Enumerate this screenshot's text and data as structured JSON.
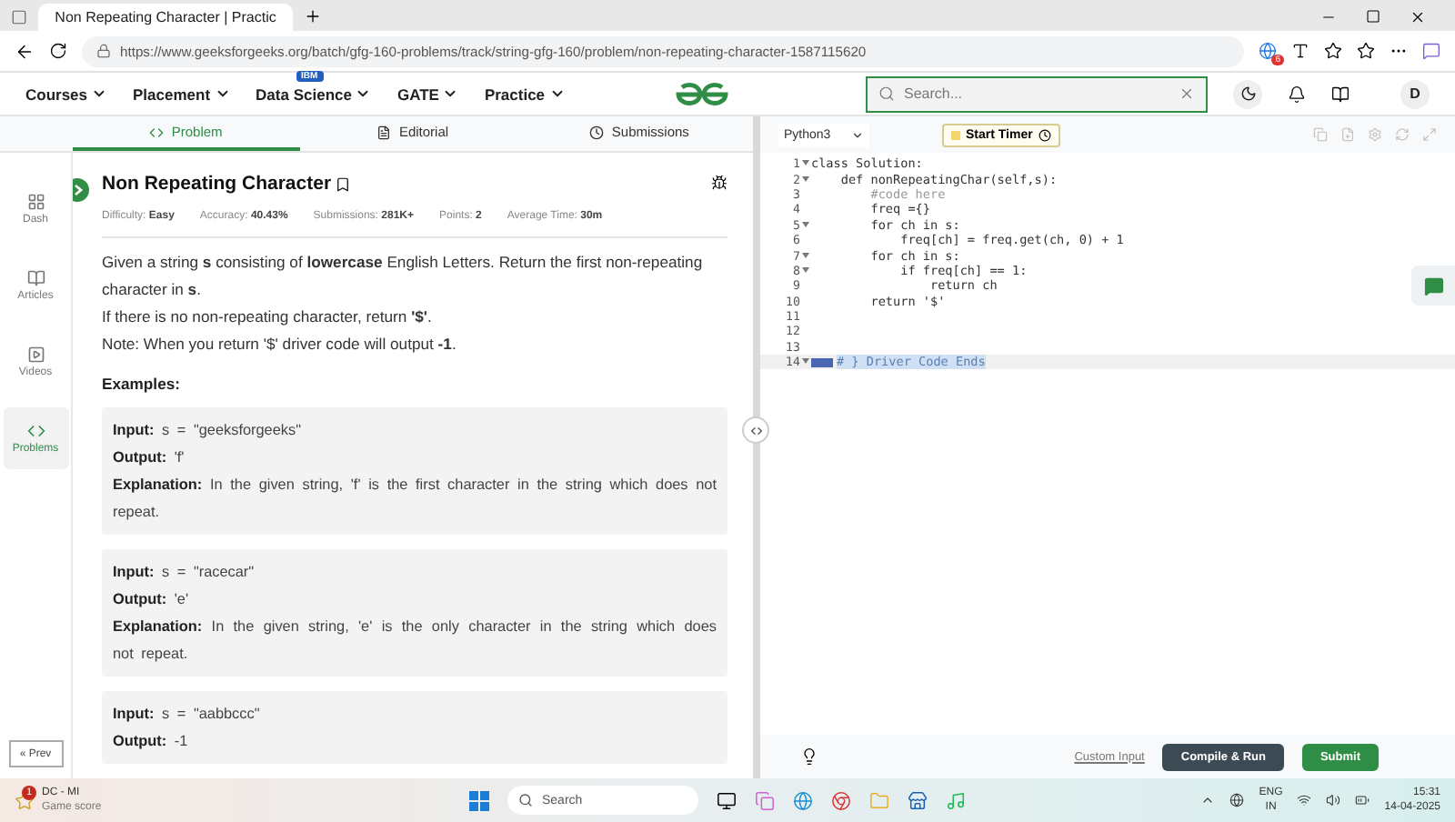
{
  "browser": {
    "tab_title": "Non Repeating Character | Practic",
    "url": "https://www.geeksforgeeks.org/batch/gfg-160-problems/track/string-gfg-160/problem/non-repeating-character-1587115620",
    "extension_badge": "6"
  },
  "nav": {
    "items": [
      {
        "label": "Courses"
      },
      {
        "label": "Placement"
      },
      {
        "label": "Data Science",
        "badge": "IBM"
      },
      {
        "label": "GATE"
      },
      {
        "label": "Practice"
      }
    ],
    "search_placeholder": "Search...",
    "avatar": "D"
  },
  "problem_tabs": [
    {
      "label": "Problem",
      "selected": true
    },
    {
      "label": "Editorial",
      "selected": false
    },
    {
      "label": "Submissions",
      "selected": false
    }
  ],
  "sidebar": {
    "items": [
      {
        "label": "Dash",
        "selected": false
      },
      {
        "label": "Articles",
        "selected": false
      },
      {
        "label": "Videos",
        "selected": false
      },
      {
        "label": "Problems",
        "selected": true
      }
    ],
    "prev": "« Prev"
  },
  "problem": {
    "title": "Non Repeating Character",
    "meta": [
      {
        "label": "Difficulty:",
        "value": "Easy"
      },
      {
        "label": "Accuracy:",
        "value": "40.43%"
      },
      {
        "label": "Submissions:",
        "value": "281K+"
      },
      {
        "label": "Points:",
        "value": "2"
      },
      {
        "label": "Average Time:",
        "value": "30m"
      }
    ],
    "description": [
      "Given a string **s** consisting of **lowercase** English Letters. Return the first non-repeating character in **s**.",
      "If there is no non-repeating character, return **'$'**.",
      "Note: When you return '$' driver code will output **-1**."
    ],
    "examples_heading": "Examples:",
    "examples": [
      [
        {
          "label": "Input:",
          "value": "s = \"geeksforgeeks\""
        },
        {
          "label": "Output:",
          "value": "'f'"
        },
        {
          "label": "Explanation:",
          "value": "In the given string, 'f' is the first character in the string which does not repeat."
        }
      ],
      [
        {
          "label": "Input:",
          "value": "s = \"racecar\""
        },
        {
          "label": "Output:",
          "value": "'e'"
        },
        {
          "label": "Explanation:",
          "value": "In the given string, 'e' is the only character in the string which does not repeat."
        }
      ],
      [
        {
          "label": "Input:",
          "value": "s = \"aabbccc\""
        },
        {
          "label": "Output:",
          "value": "-1"
        }
      ]
    ]
  },
  "editor": {
    "language": "Python3",
    "timer": "Start Timer",
    "lines": [
      {
        "no": "1",
        "code": "class Solution:",
        "fold": true,
        "highlight": false
      },
      {
        "no": "2",
        "code": "    def nonRepeatingChar(self,s):",
        "fold": true,
        "highlight": false
      },
      {
        "no": "3",
        "code": "        #code here",
        "fold": false,
        "highlight": false
      },
      {
        "no": "4",
        "code": "        freq ={}",
        "fold": false,
        "highlight": false
      },
      {
        "no": "5",
        "code": "        for ch in s:",
        "fold": true,
        "highlight": false
      },
      {
        "no": "6",
        "code": "            freq[ch] = freq.get(ch, 0) + 1",
        "fold": false,
        "highlight": false
      },
      {
        "no": "7",
        "code": "        for ch in s:",
        "fold": true,
        "highlight": false
      },
      {
        "no": "8",
        "code": "            if freq[ch] == 1:",
        "fold": true,
        "highlight": false
      },
      {
        "no": "9",
        "code": "                return ch",
        "fold": false,
        "highlight": false
      },
      {
        "no": "10",
        "code": "        return '$'",
        "fold": false,
        "highlight": false
      },
      {
        "no": "11",
        "fold": false,
        "highlight": false
      },
      {
        "no": "12",
        "fold": false,
        "highlight": false
      },
      {
        "no": "13",
        "fold": false,
        "highlight": false
      },
      {
        "no": "14",
        "code": "# } Driver Code Ends",
        "fold": true,
        "highlight": true
      }
    ],
    "custom_input": "Custom Input",
    "compile": "Compile & Run",
    "submit": "Submit"
  },
  "taskbar": {
    "widget_title": "DC - MI",
    "widget_sub": "Game score",
    "widget_badge": "1",
    "search": "Search",
    "lang_top": "ENG",
    "lang_bottom": "IN",
    "time": "15:31",
    "date": "14-04-2025"
  }
}
